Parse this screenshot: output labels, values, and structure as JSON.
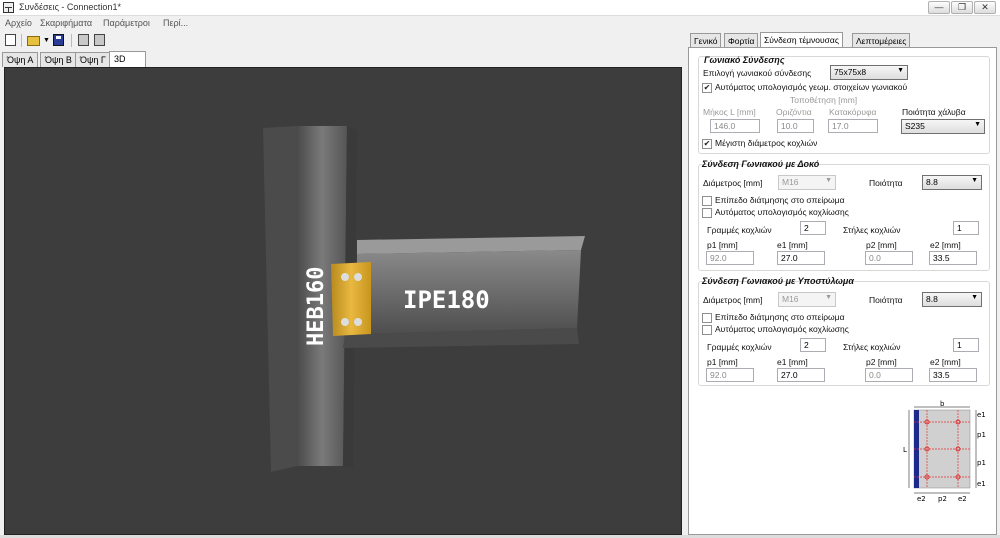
{
  "window": {
    "title": "Συνδέσεις - Connection1*",
    "minimize": "—",
    "restore": "❐",
    "close": "✕"
  },
  "menu": [
    "Αρχείο",
    "Σκαριφήματα",
    "Παράμετροι",
    "Περί..."
  ],
  "view_tabs": [
    "Όψη Α",
    "Όψη Β",
    "Όψη Γ",
    "3D"
  ],
  "viewport": {
    "column_label": "HEB160",
    "beam_label": "IPE180"
  },
  "right_tabs": [
    "Γενικό",
    "Φορτία",
    "Σύνδεση τέμνουσας",
    "Λεπτομέρειες"
  ],
  "angle": {
    "title": "Γωνιακό Σύνδεσης",
    "select_label": "Επιλογή γωνιακού σύνδεσης",
    "select_value": "75x75x8",
    "auto_label": "Αυτόματος υπολογισμός γεωμ. στοιχείων γωνιακού",
    "auto_checked": "✔",
    "placement_label": "Τοποθέτηση [mm]",
    "length_label": "Μήκος L [mm]",
    "length_value": "146.0",
    "horizontal_label": "Οριζόντια",
    "horizontal_value": "10.0",
    "vertical_label": "Κατακόρυφα",
    "vertical_value": "17.0",
    "steel_label": "Ποιότητα χάλυβα",
    "steel_value": "S235",
    "max_diam_label": "Μέγιστη διάμετρος κοχλιών",
    "max_diam_checked": "✔"
  },
  "beam_conn": {
    "title": "Σύνδεση Γωνιακού με Δοκό",
    "diameter_label": "Διάμετρος [mm]",
    "diameter_value": "M16",
    "quality_label": "Ποιότητα",
    "quality_value": "8.8",
    "thread_label": "Επίπεδο διάτμησης στο σπείρωμα",
    "auto_label": "Αυτόματος υπολογισμός κοχλίωσης",
    "rows_label": "Γραμμές κοχλιών",
    "rows_value": "2",
    "cols_label": "Στήλες κοχλιών",
    "cols_value": "1",
    "p1_label": "p1 [mm]",
    "p1_value": "92.0",
    "e1_label": "e1 [mm]",
    "e1_value": "27.0",
    "p2_label": "p2 [mm]",
    "p2_value": "0.0",
    "e2_label": "e2 [mm]",
    "e2_value": "33.5"
  },
  "col_conn": {
    "title": "Σύνδεση Γωνιακού με Υποστύλωμα",
    "diameter_label": "Διάμετρος [mm]",
    "diameter_value": "M16",
    "quality_label": "Ποιότητα",
    "quality_value": "8.8",
    "thread_label": "Επίπεδο διάτμησης στο σπείρωμα",
    "auto_label": "Αυτόματος υπολογισμός κοχλίωσης",
    "rows_label": "Γραμμές κοχλιών",
    "rows_value": "2",
    "cols_label": "Στήλες κοχλιών",
    "cols_value": "1",
    "p1_label": "p1 [mm]",
    "p1_value": "92.0",
    "e1_label": "e1 [mm]",
    "e1_value": "27.0",
    "p2_label": "p2 [mm]",
    "p2_value": "0.0",
    "e2_label": "e2 [mm]",
    "e2_value": "33.5"
  },
  "diagram": {
    "b": "b",
    "L": "L",
    "e1_top": "e1",
    "p1_top": "p1",
    "p1_bottom": "p1",
    "e1_bottom": "e1",
    "e2_left": "e2",
    "p2": "p2",
    "e2_right": "e2"
  },
  "colors": {
    "plate": "#d4a22a",
    "steel": "#6e6e6e",
    "viewport_bg": "#3d3d3d",
    "diagram_blue": "#1e2a8a",
    "diagram_red": "#e03030"
  }
}
